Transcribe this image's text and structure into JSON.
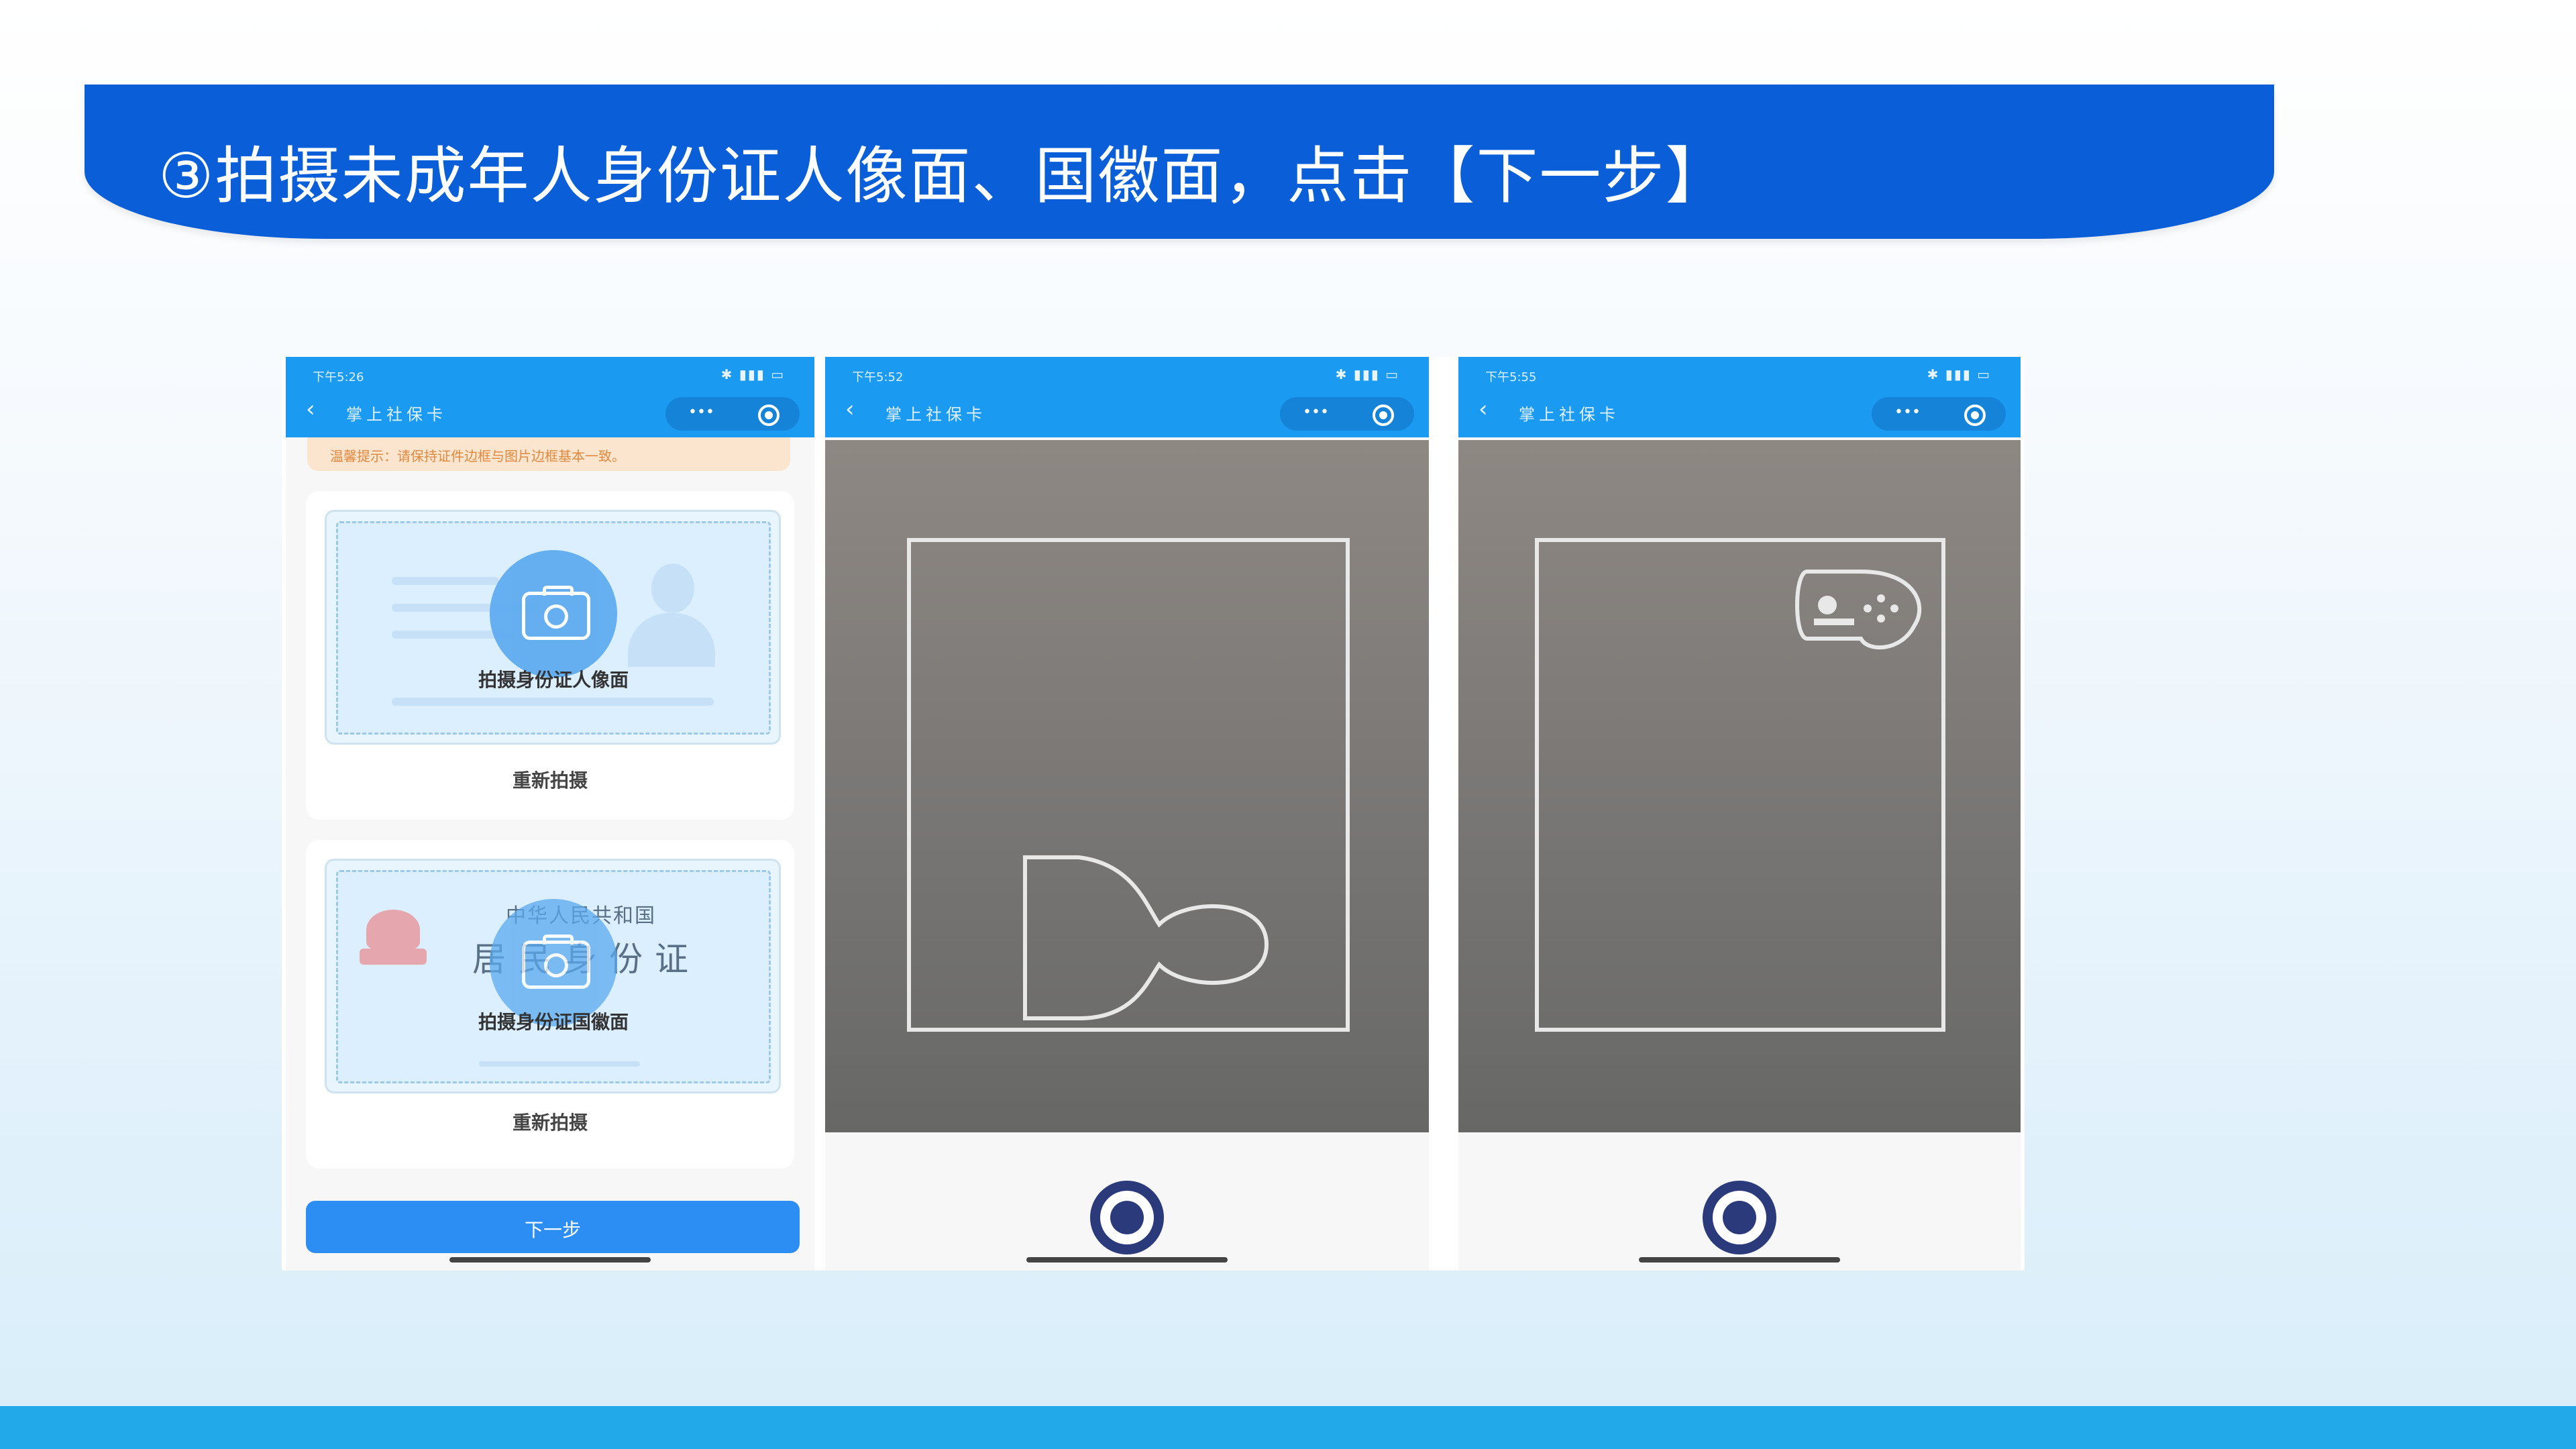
{
  "banner": {
    "title": "③拍摄未成年人身份证人像面、国徽面，点击【下一步】"
  },
  "phone1": {
    "status_time": "下午5:26",
    "status_icons": "✱ ▮▮▮ ▭",
    "back": "‹",
    "nav_title": "掌上社保卡",
    "capsule_dots": "•••",
    "tip": "温馨提示：请保持证件边框与图片边框基本一致。",
    "portrait_caption": "拍摄身份证人像面",
    "retake1": "重新拍摄",
    "id_country": "中华人民共和国",
    "id_title": "居民身份证",
    "emblem_caption": "拍摄身份证国徽面",
    "retake2": "重新拍摄",
    "next_button": "下一步"
  },
  "phone2": {
    "status_time": "下午5:52",
    "status_icons": "✱ ▮▮▮ ▭",
    "back": "‹",
    "nav_title": "掌上社保卡",
    "capsule_dots": "•••"
  },
  "phone3": {
    "status_time": "下午5:55",
    "status_icons": "✱ ▮▮▮ ▭",
    "back": "‹",
    "nav_title": "掌上社保卡",
    "capsule_dots": "•••"
  },
  "colors": {
    "banner": "#0a5fd8",
    "statusbar": "#1a9af0",
    "button": "#2c8df2",
    "bottom_bar": "#21a9ea"
  },
  "icons": [
    "back-icon",
    "more-icon",
    "target-icon",
    "camera-icon",
    "person-silhouette-icon",
    "national-emblem-icon",
    "shutter-button-icon"
  ]
}
